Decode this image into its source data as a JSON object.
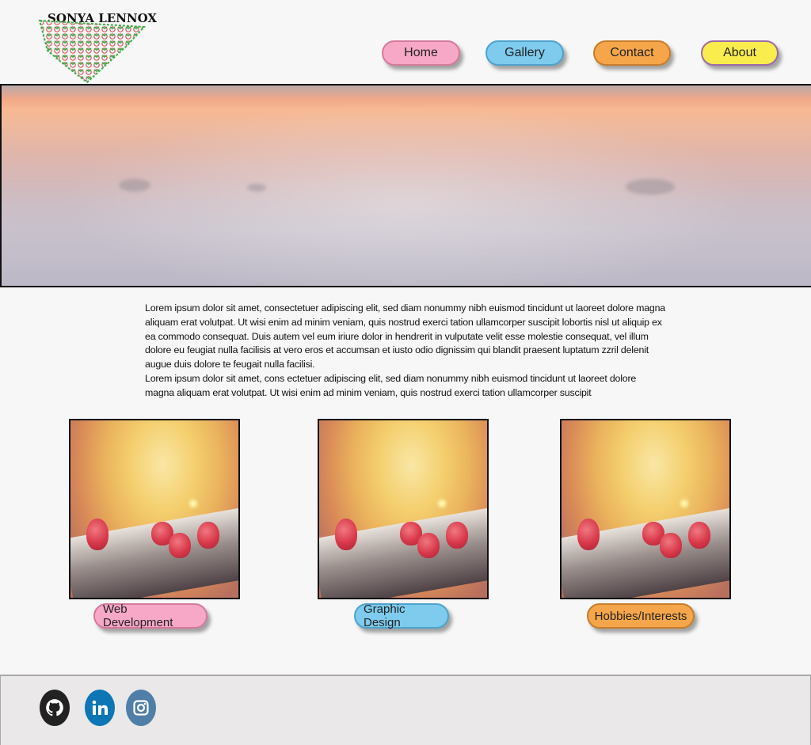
{
  "brand": {
    "logo_text": "SONYA LENNOX"
  },
  "nav": {
    "home": "Home",
    "gallery": "Gallery",
    "contact": "Contact",
    "about": "About"
  },
  "content": {
    "paragraph1": "Lorem ipsum dolor sit amet, consectetuer adipiscing elit, sed diam nonummy nibh euismod tincidunt ut laoreet dolore magna aliquam erat volutpat. Ut wisi enim ad minim veniam, quis nostrud exerci tation ullamcorper suscipit lobortis nisl ut aliquip ex ea commodo consequat. Duis autem vel eum iriure dolor in hendrerit in vulputate velit esse molestie consequat, vel illum dolore eu feugiat nulla facilisis at vero eros et accumsan et iusto odio dignissim qui blandit praesent luptatum zzril delenit augue duis dolore te feugait nulla facilisi.",
    "paragraph2": "Lorem ipsum dolor sit amet, cons ectetuer adipiscing elit, sed diam nonummy nibh euismod tincidunt ut laoreet dolore magna aliquam erat volutpat. Ut wisi enim ad minim veniam, quis nostrud exerci tation ullamcorper suscipit"
  },
  "categories": [
    {
      "label": "Web Development"
    },
    {
      "label": "Graphic Design"
    },
    {
      "label": "Hobbies/Interests"
    }
  ],
  "colors": {
    "pink": "#f7a8c6",
    "blue": "#7ecbee",
    "orange": "#f6a64a",
    "yellow": "#f9ed4e",
    "github": "#222222",
    "linkedin": "#0e76b5",
    "instagram": "#4f7fa8"
  },
  "social": {
    "icons": [
      "github-icon",
      "linkedin-icon",
      "instagram-icon"
    ]
  }
}
